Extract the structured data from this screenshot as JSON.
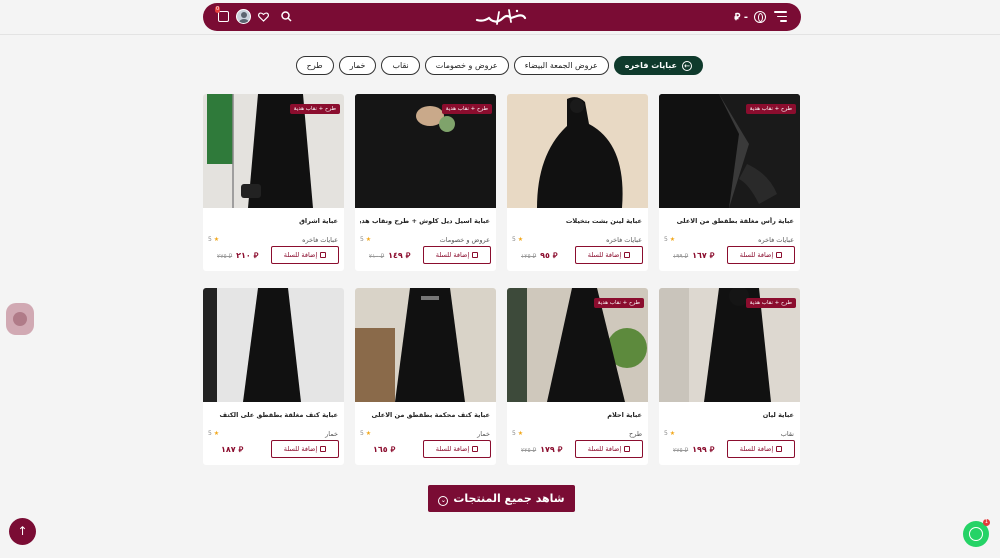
{
  "header": {
    "currency": "⃁ -",
    "cart_badge": "0"
  },
  "categories": [
    {
      "label": "عبايات فاخره",
      "active": true
    },
    {
      "label": "عروض الجمعة البيضاء"
    },
    {
      "label": "عروض و خصومات"
    },
    {
      "label": "نقاب"
    },
    {
      "label": "خمار"
    },
    {
      "label": "طرح"
    }
  ],
  "common": {
    "add_to_cart": "إضافة للسلة",
    "rating": "5",
    "badge": "طرح + نقاب هدية"
  },
  "products": [
    {
      "title": "عباية رأس مغلقة بطقطق من الاعلى",
      "category": "عبايات فاخره",
      "price": "⃁ ١٦٧",
      "old_price": "⃁ ١٩٩",
      "badge": true
    },
    {
      "title": "عباية لينن بشت بتخيلات",
      "category": "عبايات فاخره",
      "price": "⃁ ٩٥",
      "old_price": "⃁ ١٢٥",
      "badge": false
    },
    {
      "title": "عباية اسيل ديل كلوش + طرح ونقاب هدية",
      "category": "عروض و خصومات",
      "price": "⃁ ١٤٩",
      "old_price": "⃁ ٢١٠",
      "badge": true
    },
    {
      "title": "عباية اشراق",
      "category": "عبايات فاخره",
      "price": "⃁ ٢١٠",
      "old_price": "⃁ ٢٧٥",
      "badge": true
    },
    {
      "title": "عباية ليان",
      "category": "نقاب",
      "price": "⃁ ١٩٩",
      "old_price": "⃁ ٢٧٥",
      "badge": true
    },
    {
      "title": "عباية احلام",
      "category": "طرح",
      "price": "⃁ ١٧٩",
      "old_price": "⃁ ٢٢٥",
      "badge": true
    },
    {
      "title": "عباية كتف محكمة بطقطق من الاعلى",
      "category": "خمار",
      "price": "⃁ ١٦٥",
      "old_price": "",
      "badge": false
    },
    {
      "title": "عباية كتف مغلقة بطقطق على الكتف",
      "category": "خمار",
      "price": "⃁ ١٨٧",
      "old_price": "",
      "badge": false
    }
  ],
  "view_all": "شاهد جميع المنتجات",
  "whatsapp_badge": "1",
  "colors": {
    "brand": "#7a0c34",
    "active_pill": "#0f3a2c",
    "star": "#f2a81d",
    "whatsapp": "#25d366"
  }
}
